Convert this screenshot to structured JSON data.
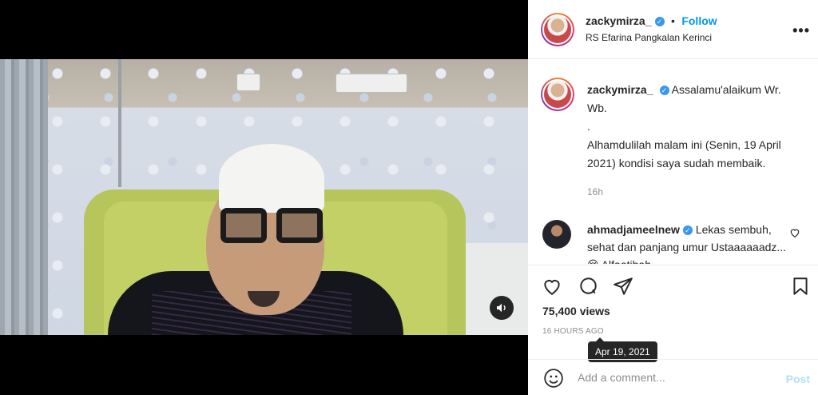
{
  "post": {
    "username": "zackymirza_",
    "follow_label": "Follow",
    "dot": "•",
    "location": "RS Efarina Pangkalan Kerinci",
    "more_label": "•••"
  },
  "caption": {
    "username": "zackymirza_",
    "line1": "Assalamu'alaikum Wr. Wb.",
    "line2": ".",
    "line3": "Alhamdulilah malam ini (Senin, 19 April 2021) kondisi saya sudah membaik.",
    "time": "16h"
  },
  "comment": {
    "username": "ahmadjameelnew",
    "text": "Lekas sembuh, sehat dan panjang umur Ustaaaaaadz... 😢 Alfaatihah"
  },
  "stats": {
    "views": "75,400 views",
    "ago": "16 HOURS AGO",
    "tooltip": "Apr 19, 2021"
  },
  "add_comment": {
    "placeholder": "Add a comment...",
    "post_label": "Post"
  },
  "colors": {
    "accent": "#0095f6",
    "verified": "#3897f0",
    "post_disabled": "#b2dffc",
    "chair": "#b7c65c"
  }
}
